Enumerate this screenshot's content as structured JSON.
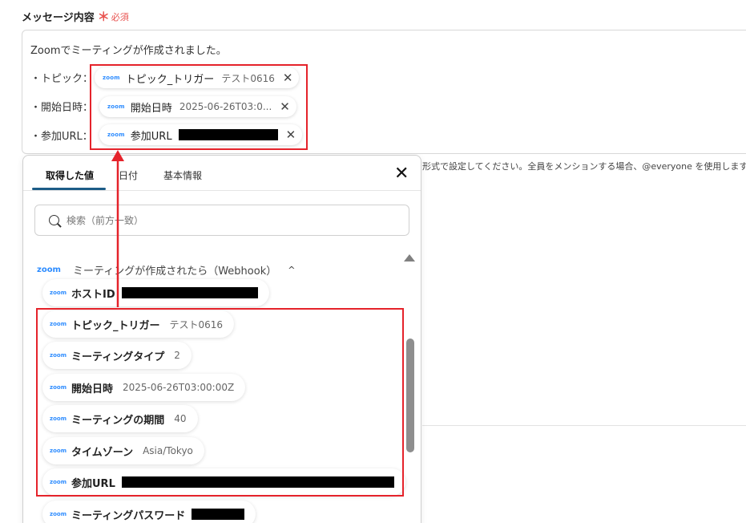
{
  "field": {
    "label": "メッセージ内容",
    "required_mark": "＊",
    "required_text": "必須"
  },
  "editor": {
    "line1": "Zoomでミーティングが作成されました。",
    "line2_label": "・トピック：",
    "line3_label": "・開始日時：",
    "line4_label": "・参加URL：",
    "chips": [
      {
        "logo": "zoom",
        "label": "トピック_トリガー",
        "value": "テスト0616",
        "close": "✕"
      },
      {
        "logo": "zoom",
        "label": "開始日時",
        "value": "2025-06-26T03:0...",
        "close": "✕"
      },
      {
        "logo": "zoom",
        "label": "参加URL",
        "value": "",
        "close": "✕",
        "redacted": true
      }
    ]
  },
  "hint": "形式で設定してください。全員をメンションする場合、@everyone を使用します。",
  "panel": {
    "tabs": [
      "取得した値",
      "日付",
      "基本情報"
    ],
    "active_tab": "取得した値",
    "close_icon": "✕",
    "search_placeholder": "検索（前方一致）",
    "group": {
      "logo": "zoom",
      "title": "ミーティングが作成されたら（Webhook）",
      "chevron": "^"
    },
    "items": [
      {
        "label": "ホストID",
        "value": "",
        "redacted": true
      },
      {
        "label": "トピック_トリガー",
        "value": "テスト0616"
      },
      {
        "label": "ミーティングタイプ",
        "value": "2"
      },
      {
        "label": "開始日時",
        "value": "2025-06-26T03:00:00Z"
      },
      {
        "label": "ミーティングの期間",
        "value": "40"
      },
      {
        "label": "タイムゾーン",
        "value": "Asia/Tokyo"
      },
      {
        "label": "参加URL",
        "value": "",
        "redacted": true
      },
      {
        "label": "ミーティングパスワード",
        "value": "",
        "redacted": true
      }
    ],
    "item_logo": "zoom"
  },
  "annotation_color": "#e5232b",
  "accent_color": "#1c5c87",
  "zoom_color": "#2d8cff"
}
